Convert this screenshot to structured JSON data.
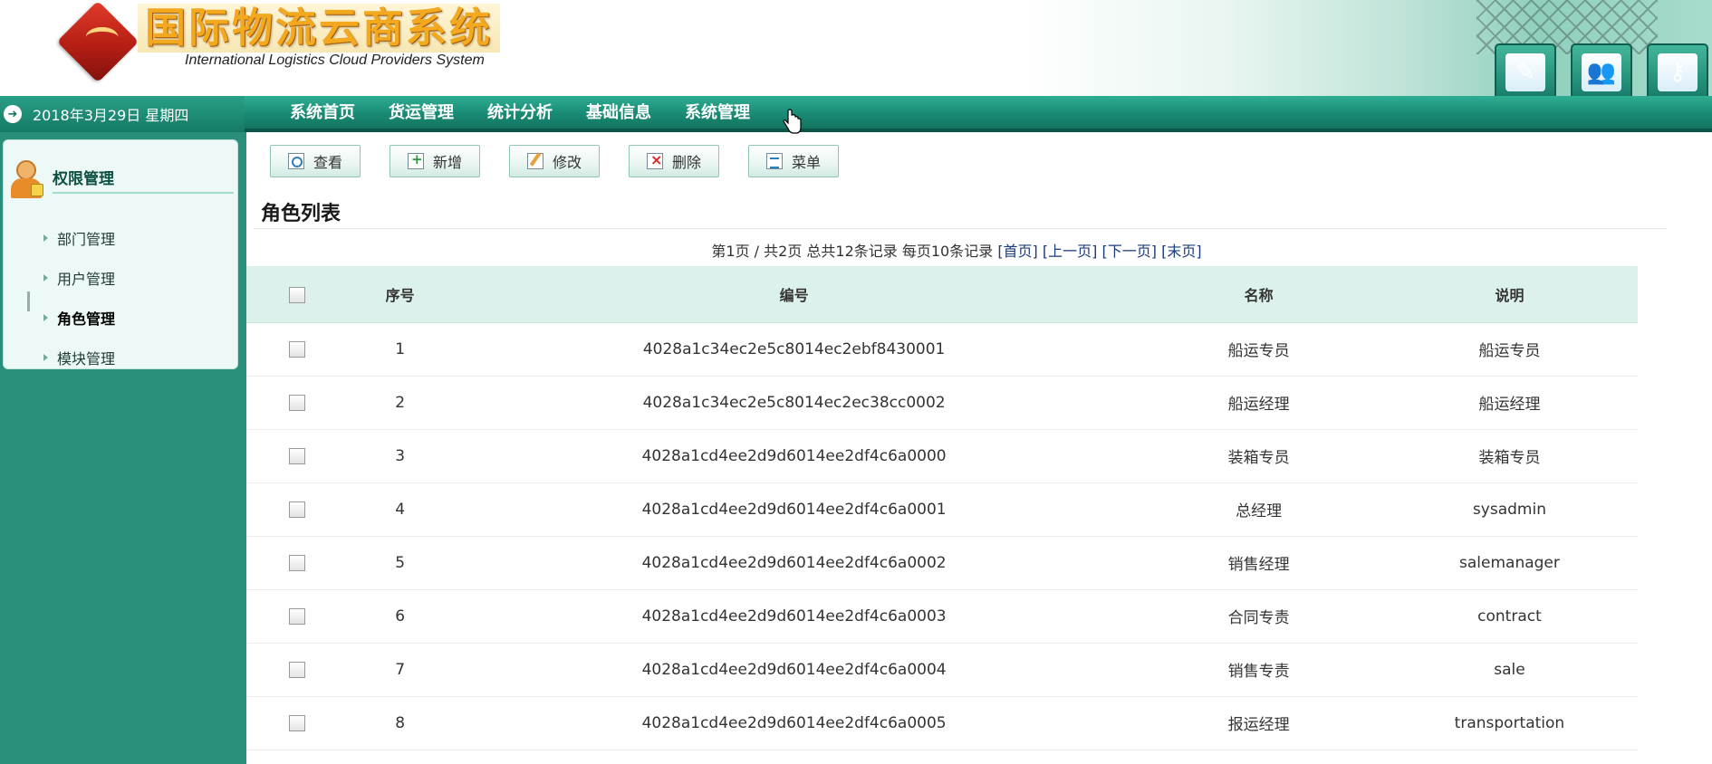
{
  "header": {
    "title": "国际物流云商系统",
    "subtitle": "International Logistics Cloud Providers System",
    "buttons": [
      {
        "icon": "edit-pen-icon"
      },
      {
        "icon": "users-icon"
      },
      {
        "icon": "keys-icon"
      }
    ]
  },
  "datebar": {
    "date": "2018年3月29日 星期四"
  },
  "nav": {
    "items": [
      {
        "label": "系统首页"
      },
      {
        "label": "货运管理"
      },
      {
        "label": "统计分析"
      },
      {
        "label": "基础信息"
      },
      {
        "label": "系统管理"
      }
    ]
  },
  "sidebar": {
    "heading": "权限管理",
    "items": [
      {
        "label": "部门管理"
      },
      {
        "label": "用户管理"
      },
      {
        "label": "角色管理"
      },
      {
        "label": "模块管理"
      }
    ]
  },
  "toolbar": {
    "view_label": "查看",
    "add_label": "新增",
    "edit_label": "修改",
    "delete_label": "删除",
    "menu_label": "菜单"
  },
  "main": {
    "list_title": "角色列表",
    "pager": {
      "summary": "第1页 / 共2页  总共12条记录 每页10条记录",
      "first": "[首页]",
      "prev": "[上一页]",
      "next": "[下一页]",
      "last": "[末页]"
    },
    "table": {
      "headers": {
        "seq": "序号",
        "id": "编号",
        "name": "名称",
        "desc": "说明"
      },
      "rows": [
        {
          "seq": "1",
          "id": "4028a1c34ec2e5c8014ec2ebf8430001",
          "name": "船运专员",
          "desc": "船运专员"
        },
        {
          "seq": "2",
          "id": "4028a1c34ec2e5c8014ec2ec38cc0002",
          "name": "船运经理",
          "desc": "船运经理"
        },
        {
          "seq": "3",
          "id": "4028a1cd4ee2d9d6014ee2df4c6a0000",
          "name": "装箱专员",
          "desc": "装箱专员"
        },
        {
          "seq": "4",
          "id": "4028a1cd4ee2d9d6014ee2df4c6a0001",
          "name": "总经理",
          "desc": "sysadmin"
        },
        {
          "seq": "5",
          "id": "4028a1cd4ee2d9d6014ee2df4c6a0002",
          "name": "销售经理",
          "desc": "salemanager"
        },
        {
          "seq": "6",
          "id": "4028a1cd4ee2d9d6014ee2df4c6a0003",
          "name": "合同专责",
          "desc": "contract"
        },
        {
          "seq": "7",
          "id": "4028a1cd4ee2d9d6014ee2df4c6a0004",
          "name": "销售专责",
          "desc": "sale"
        },
        {
          "seq": "8",
          "id": "4028a1cd4ee2d9d6014ee2df4c6a0005",
          "name": "报运经理",
          "desc": "transportation"
        }
      ]
    }
  }
}
